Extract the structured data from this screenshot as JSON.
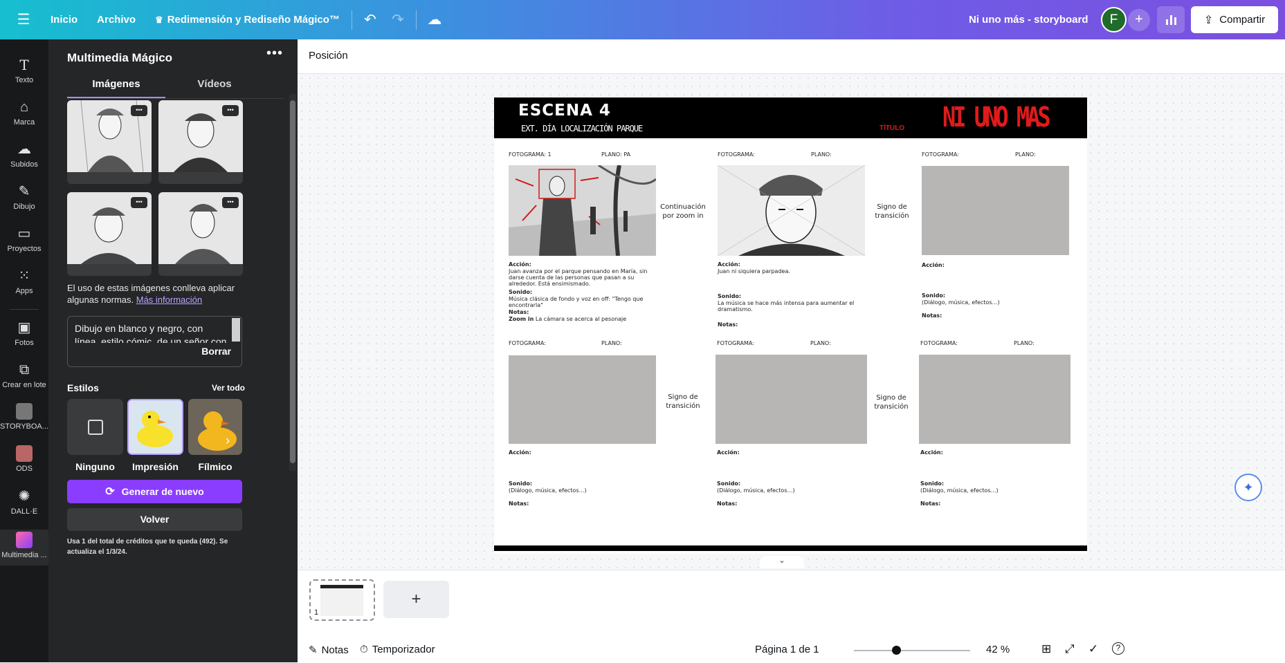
{
  "topbar": {
    "inicio": "Inicio",
    "archivo": "Archivo",
    "magic": "Redimensión y Rediseño Mágico™",
    "title": "Ni uno más - storyboard",
    "avatar": "F",
    "share": "Compartir"
  },
  "rail": [
    {
      "icon": "text-icon",
      "label": "Texto"
    },
    {
      "icon": "brand-icon",
      "label": "Marca"
    },
    {
      "icon": "upload-icon",
      "label": "Subidos"
    },
    {
      "icon": "draw-icon",
      "label": "Dibujo"
    },
    {
      "icon": "folder-icon",
      "label": "Proyectos"
    },
    {
      "icon": "apps-icon",
      "label": "Apps"
    },
    {
      "icon": "photo-icon",
      "label": "Fotos"
    },
    {
      "icon": "bulk-icon",
      "label": "Crear en lote"
    },
    {
      "icon": "storyboard-thumb",
      "label": "STORYBOA..."
    },
    {
      "icon": "ods-thumb",
      "label": "ODS"
    },
    {
      "icon": "dalle-icon",
      "label": "DALL·E"
    },
    {
      "icon": "magic-media-icon",
      "label": "Multimedia ..."
    }
  ],
  "panel": {
    "title": "Multimedia Mágico",
    "tab_images": "Imágenes",
    "tab_videos": "Vídeos",
    "notice": "El uso de estas imágenes conlleva aplicar algunas normas.",
    "more_info": "Más información",
    "prompt": "Dibujo en blanco y negro, con línea, estilo cómic, de un señor con",
    "clear": "Borrar",
    "styles": "Estilos",
    "see_all": "Ver todo",
    "style_none": "Ninguno",
    "style_print": "Impresión",
    "style_film": "Fílmico",
    "generate": "Generar de nuevo",
    "back": "Volver",
    "credits": "Usa 1 del total de créditos que te queda (492). Se actualiza el 1/3/24."
  },
  "canvas": {
    "position": "Posición"
  },
  "storyboard": {
    "scene": "ESCENA 4",
    "ext": "EXT. DÍA",
    "location": "LOCALIZACIÓN PARQUE",
    "title_label": "TÍTULO",
    "title": "NI UNO MAS",
    "cells": [
      {
        "frame": "FOTOGRAMA: 1",
        "plane": "PLANO:  PA",
        "action_label": "Acción:",
        "action": "Juan avanza por el parque pensando en María, sin darse cuenta de las personas que pasan a su alrededor. Está ensimismado.",
        "sound_label": "Sonido:",
        "sound": "Música clásica de fondo y voz en off: \"Tengo que encontrarla\"",
        "notes_label": "Notas:",
        "zoom_label": "Zoom in",
        "zoom": "La cámara se acerca al pesonaje"
      },
      {
        "frame": "FOTOGRAMA:",
        "plane": "PLANO:",
        "action_label": "Acción:",
        "action": "Juan ni siquiera parpadea.",
        "sound_label": "Sonido:",
        "sound": "La música se hace más intensa para aumentar el dramatismo.",
        "notes_label": "Notas:"
      },
      {
        "frame": "FOTOGRAMA:",
        "plane": "PLANO:",
        "action_label": "Acción:",
        "action": "",
        "sound_label": "Sonido:",
        "sound": "(Diálogo, música, efectos…)",
        "notes_label": "Notas:"
      },
      {
        "frame": "FOTOGRAMA:",
        "plane": "PLANO:",
        "action_label": "Acción:",
        "action": "",
        "sound_label": "Sonido:",
        "sound": "(Diálogo, música, efectos…)",
        "notes_label": "Notas:"
      },
      {
        "frame": "FOTOGRAMA:",
        "plane": "PLANO:",
        "action_label": "Acción:",
        "action": "",
        "sound_label": "Sonido:",
        "sound": "(Diálogo, música, efectos…)",
        "notes_label": "Notas:"
      },
      {
        "frame": "FOTOGRAMA:",
        "plane": "PLANO:",
        "action_label": "Acción:",
        "action": "",
        "sound_label": "Sonido:",
        "sound": "(Diálogo, música, efectos…)",
        "notes_label": "Notas:"
      }
    ],
    "trans1": "Continuación por zoom in",
    "trans2": "Signo de transición",
    "trans3": "Signo de transición",
    "trans4": "Signo de transición"
  },
  "bottom": {
    "page_num": "1",
    "notes": "Notas",
    "timer": "Temporizador",
    "page_info": "Página 1 de 1",
    "zoom": "42 %"
  },
  "colors": {
    "accent": "#8b3dff",
    "title_red": "#e01b1b"
  }
}
